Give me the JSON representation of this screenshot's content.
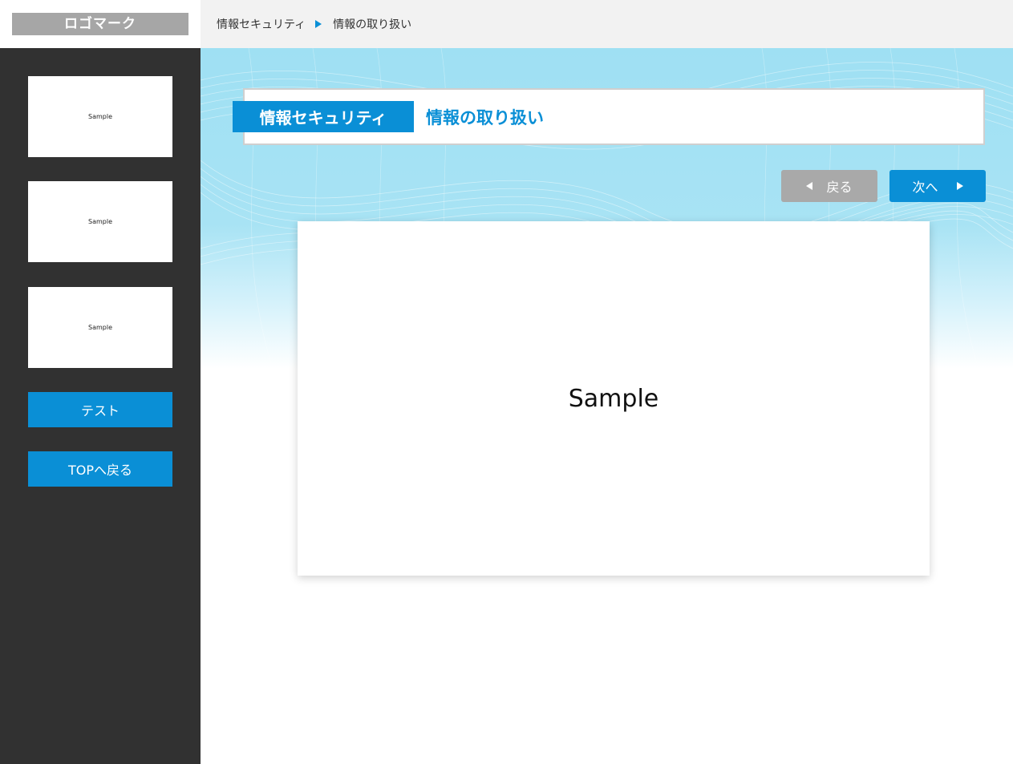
{
  "header": {
    "logo": "ロゴマーク",
    "breadcrumb": [
      "情報セキュリティ",
      "情報の取り扱い"
    ]
  },
  "sidebar": {
    "thumbnails": [
      {
        "label": "Sample"
      },
      {
        "label": "Sample"
      },
      {
        "label": "Sample"
      }
    ],
    "test_button": "テスト",
    "top_button": "TOPへ戻る"
  },
  "main": {
    "category_tag": "情報セキュリティ",
    "lesson_title": "情報の取り扱い",
    "back_button": "戻る",
    "next_button": "次へ",
    "slide_label": "Sample"
  },
  "colors": {
    "accent": "#0a8fd6",
    "sidebar_bg": "#313131",
    "header_bg": "#f2f2f2",
    "logo_bg": "#a6a6a6",
    "back_button_bg": "#a9a9a9"
  }
}
